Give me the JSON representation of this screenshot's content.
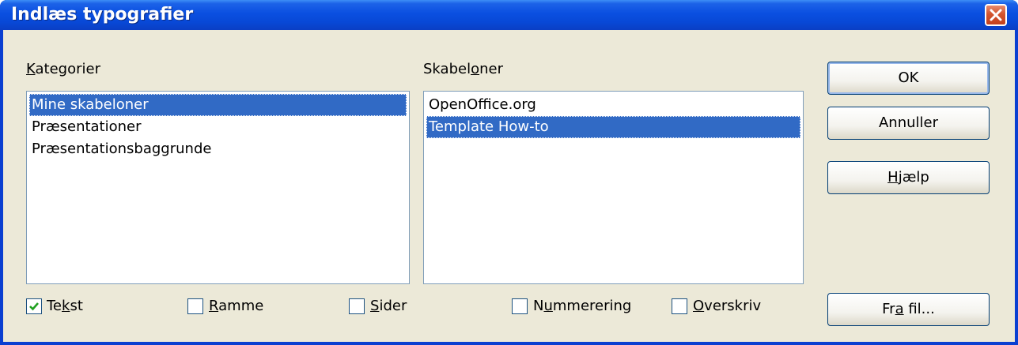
{
  "window": {
    "title": "Indlæs typografier"
  },
  "kategorier": {
    "label_underlined": "K",
    "label_rest": "ategorier",
    "items": [
      {
        "label": "Mine skabeloner",
        "selected": true
      },
      {
        "label": "Præsentationer",
        "selected": false
      },
      {
        "label": "Præsentationsbaggrunde",
        "selected": false
      }
    ]
  },
  "skabeloner": {
    "label_before": "Skabel",
    "label_underlined": "o",
    "label_after": "ner",
    "items": [
      {
        "label": "OpenOffice.org",
        "selected": false
      },
      {
        "label": "Template How-to",
        "selected": true
      }
    ]
  },
  "buttons": {
    "ok": "OK",
    "cancel": "Annuller",
    "help_underlined": "H",
    "help_rest": "jælp",
    "from_file_before": "Fr",
    "from_file_underlined": "a",
    "from_file_after": " fil..."
  },
  "options": [
    {
      "before": "Te",
      "underlined": "k",
      "after": "st",
      "checked": true
    },
    {
      "before": "",
      "underlined": "R",
      "after": "amme",
      "checked": false
    },
    {
      "before": "",
      "underlined": "S",
      "after": "ider",
      "checked": false
    },
    {
      "before": "N",
      "underlined": "u",
      "after": "mmerering",
      "checked": false
    },
    {
      "before": "",
      "underlined": "O",
      "after": "verskriv",
      "checked": false
    }
  ],
  "colors": {
    "titlebar": "#0a4fe0",
    "selection": "#316ac5",
    "dialog_bg": "#ece9d8",
    "close_button": "#d2552f"
  },
  "icons": {
    "close": "close-icon",
    "check": "check-icon"
  }
}
